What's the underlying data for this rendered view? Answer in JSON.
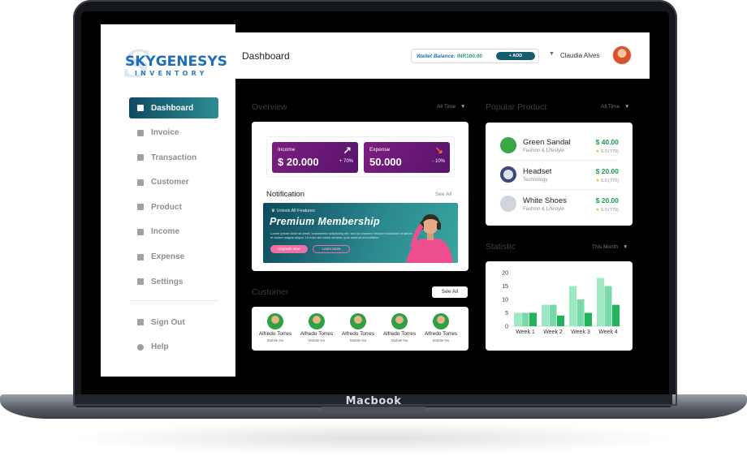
{
  "device": {
    "label": "Macbook"
  },
  "logo": {
    "main": "SKYGENESYS",
    "sub": "INVENTORY",
    "mark": "S"
  },
  "sidebar": {
    "items": [
      {
        "label": "Dashboard",
        "icon": "grid-icon",
        "active": true
      },
      {
        "label": "Invoice",
        "icon": "invoice-icon"
      },
      {
        "label": "Transaction",
        "icon": "transaction-icon"
      },
      {
        "label": "Customer",
        "icon": "customer-icon"
      },
      {
        "label": "Product",
        "icon": "product-icon"
      },
      {
        "label": "Income",
        "icon": "income-icon"
      },
      {
        "label": "Expense",
        "icon": "expense-icon"
      },
      {
        "label": "Settings",
        "icon": "gear-icon"
      }
    ],
    "bottom": [
      {
        "label": "Sign Out",
        "icon": "sign-out-icon"
      },
      {
        "label": "Help",
        "icon": "help-icon"
      }
    ]
  },
  "header": {
    "title": "Dashboard",
    "wallet_label": "Wallet Balance:",
    "wallet_value": "INR100.00",
    "add_label": "+ ADD",
    "user_name": "Claudia Alves"
  },
  "overview": {
    "label": "Overview",
    "filter": "All Time",
    "income": {
      "label": "Income",
      "value": "$ 20.000",
      "change": "+ 70%"
    },
    "expense": {
      "label": "Expense",
      "value": "50.000",
      "change": "- 10%"
    }
  },
  "notification": {
    "title": "Notification",
    "see_all": "See All",
    "banner_small": "Unlock All Features",
    "banner_title": "Premium Membership",
    "banner_text": "Lorem ipsum dolor sit amet, consectetur adipiscing elit, sed do eiusmod tempor incididunt ut labore et dolore magna aliqua. Ut enim ad minim veniam, quis nostrud exercitation",
    "btn_primary": "Upgrade Now",
    "btn_secondary": "Learn More"
  },
  "popular": {
    "label": "Popular Product",
    "filter": "All Time",
    "items": [
      {
        "name": "Green Sandal",
        "category": "Fashion & Lifestyle",
        "price": "$ 40.00",
        "rating": "5.0 (770)",
        "img_color": "#3aa647"
      },
      {
        "name": "Headset",
        "category": "Technology",
        "price": "$ 20.00",
        "rating": "5.0 (770)",
        "img_color": "#3c4a7a"
      },
      {
        "name": "White Shoes",
        "category": "Fashion & Lifestyle",
        "price": "$ 20.00",
        "rating": "5.0 (770)",
        "img_color": "#cfd5db"
      }
    ]
  },
  "customer": {
    "label": "Customer",
    "see_all": "See All",
    "items": [
      {
        "name": "Alfredo Torres",
        "sub": "Mobile No"
      },
      {
        "name": "Alfredo Torres",
        "sub": "Mobile No"
      },
      {
        "name": "Alfredo Torres",
        "sub": "Mobile No"
      },
      {
        "name": "Alfredo Torres",
        "sub": "Mobile No"
      },
      {
        "name": "Alfredo Torres",
        "sub": "Mobile No"
      }
    ]
  },
  "statistic": {
    "label": "Statistic",
    "filter": "This Month"
  },
  "chart_data": {
    "type": "bar",
    "categories": [
      "Week 1",
      "Week 2",
      "Week 3",
      "Week 4"
    ],
    "series": [
      {
        "values": [
          5,
          8,
          15,
          18
        ],
        "color": "#9fe8c4"
      },
      {
        "values": [
          5,
          8,
          10,
          15
        ],
        "color": "#7ad9a8"
      },
      {
        "values": [
          5,
          4,
          5,
          8
        ],
        "color": "#22b35a"
      }
    ],
    "ylim": [
      0,
      20
    ],
    "yticks": [
      0,
      5,
      10,
      15,
      20
    ]
  },
  "colors": {
    "accent": "#145c6e",
    "purple": "#6b1876",
    "price_green": "#1e9a55"
  }
}
